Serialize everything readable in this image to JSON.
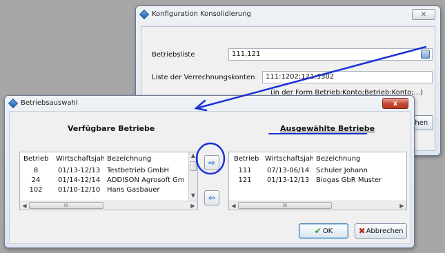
{
  "konfig": {
    "title": "Konfiguration Konsolidierung",
    "close_label": "✕",
    "betriebsliste_label": "Betriebsliste",
    "betriebsliste_value": "111,121",
    "konten_label": "Liste der Verrechnungskonten",
    "konten_value": "111:1202;121:3302",
    "hint": "(in der Form Betrieb:Konto;Betrieb:Konto;...)",
    "partial_button_label": "chen"
  },
  "auswahl": {
    "title": "Betriebsauswahl",
    "close_label": "x",
    "available_heading": "Verfügbare Betriebe",
    "selected_heading": "Ausgewählte Betriebe",
    "columns": [
      "Betrieb",
      "Wirtschaftsjahr",
      "Bezeichnung"
    ],
    "available_rows": [
      {
        "betrieb": "8",
        "jahr": "01/13-12/13",
        "bez": "Testbetrieb GmbH"
      },
      {
        "betrieb": "24",
        "jahr": "01/14-12/14",
        "bez": "ADDISON Agrosoft Gm"
      },
      {
        "betrieb": "102",
        "jahr": "01/10-12/10",
        "bez": "Hans Gasbauer"
      }
    ],
    "selected_rows": [
      {
        "betrieb": "111",
        "jahr": "07/13-06/14",
        "bez": "Schuler Johann"
      },
      {
        "betrieb": "121",
        "jahr": "01/13-12/13",
        "bez": "Biogas GbR Muster"
      }
    ],
    "add_button_label": "⇨",
    "remove_button_label": "⇦",
    "ok_label": "OK",
    "cancel_label": "Abbrechen",
    "ok_icon": "check-icon",
    "cancel_icon": "x-icon",
    "scroll_thumb_glyph": "III"
  },
  "colors": {
    "annotation_blue": "#1a2fd8"
  }
}
